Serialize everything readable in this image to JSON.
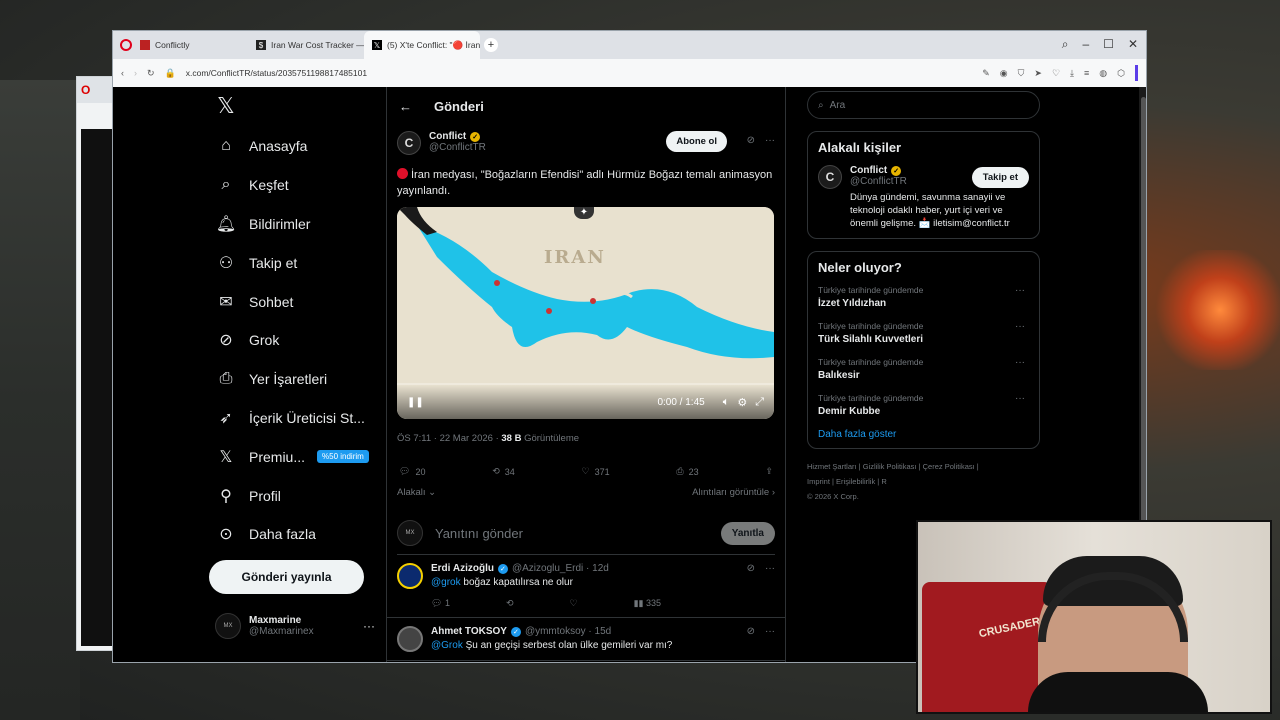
{
  "browser": {
    "tabs": [
      {
        "label": "Conflictly",
        "active": false
      },
      {
        "label": "Iran War Cost Tracker — L",
        "active": false
      },
      {
        "label": "(5) X'te Conflict: \"🔴 İran",
        "active": true
      }
    ],
    "url": "x.com/ConflictTR/status/2035751198817485101"
  },
  "nav": {
    "items": [
      {
        "label": "Anasayfa",
        "icon": "home-icon"
      },
      {
        "label": "Keşfet",
        "icon": "search-icon"
      },
      {
        "label": "Bildirimler",
        "icon": "bell-icon",
        "badge": "5"
      },
      {
        "label": "Takip et",
        "icon": "add-user-icon"
      },
      {
        "label": "Sohbet",
        "icon": "mail-icon"
      },
      {
        "label": "Grok",
        "icon": "grok-icon"
      },
      {
        "label": "Yer İşaretleri",
        "icon": "bookmark-icon"
      },
      {
        "label": "İçerik Üreticisi St...",
        "icon": "rocket-icon"
      },
      {
        "label": "Premiu...",
        "icon": "x-icon",
        "badge": "%50 indirim"
      },
      {
        "label": "Profil",
        "icon": "profile-icon"
      },
      {
        "label": "Daha fazla",
        "icon": "more-icon"
      }
    ],
    "post_button": "Gönderi yayınla",
    "user": {
      "name": "Maxmarine",
      "handle": "@Maxmarinex"
    }
  },
  "header": {
    "title": "Gönderi"
  },
  "post": {
    "author": "Conflict",
    "handle": "@ConflictTR",
    "subscribe": "Abone ol",
    "text": "İran medyası, \"Boğazların Efendisi\" adlı Hürmüz Boğazı temalı animasyon yayınlandı.",
    "video": {
      "map_label": "IRAN",
      "time": "0:00 / 1:45",
      "progress": 0.0
    },
    "meta_time": "ÖS 7:11 · 22 Mar 2026 · ",
    "views_count": "38 B",
    "views_label": " Görüntüleme",
    "stats": {
      "replies": "20",
      "reposts": "34",
      "likes": "371",
      "bookmarks": "23"
    },
    "sort_label": "Alakalı",
    "quotes_label": "Alıntıları görüntüle"
  },
  "reply_box": {
    "placeholder": "Yanıtını gönder",
    "button": "Yanıtla"
  },
  "replies": [
    {
      "name": "Erdi Azizoğlu",
      "handle": "@Azizoglu_Erdi · 12d",
      "mention": "@grok",
      "text": " boğaz kapatılırsa ne olur",
      "replies": "1",
      "views": "335"
    },
    {
      "name": "Ahmet TOKSOY",
      "handle": "@ymmtoksoy · 15d",
      "mention": "@Grok",
      "text": " Şu an geçişi serbest olan ülke gemileri var mı?"
    }
  ],
  "right": {
    "search_placeholder": "Ara",
    "people_title": "Alakalı kişiler",
    "person": {
      "name": "Conflict",
      "handle": "@ConflictTR",
      "follow": "Takip et",
      "bio": "Dünya gündemi, savunma sanayii ve teknoloji odaklı haber, yurt içi veri ve önemli gelişme. 📩 iletisim@conflict.tr"
    },
    "trends_title": "Neler oluyor?",
    "trends": [
      {
        "context": "Türkiye tarihinde gündemde",
        "title": "İzzet Yıldızhan"
      },
      {
        "context": "Türkiye tarihinde gündemde",
        "title": "Türk Silahlı Kuvvetleri"
      },
      {
        "context": "Türkiye tarihinde gündemde",
        "title": "Balıkesir"
      },
      {
        "context": "Türkiye tarihinde gündemde",
        "title": "Demir Kubbe"
      }
    ],
    "show_more": "Daha fazla göster",
    "footer_links": [
      "Hizmet Şartları",
      "Gizlilik Politikası",
      "Çerez Politikası",
      "Imprint",
      "Erişilebilirlik",
      "R"
    ],
    "copyright": "© 2026 X Corp."
  },
  "webcam": {
    "logo_text": "CRUSADER KINGS"
  }
}
